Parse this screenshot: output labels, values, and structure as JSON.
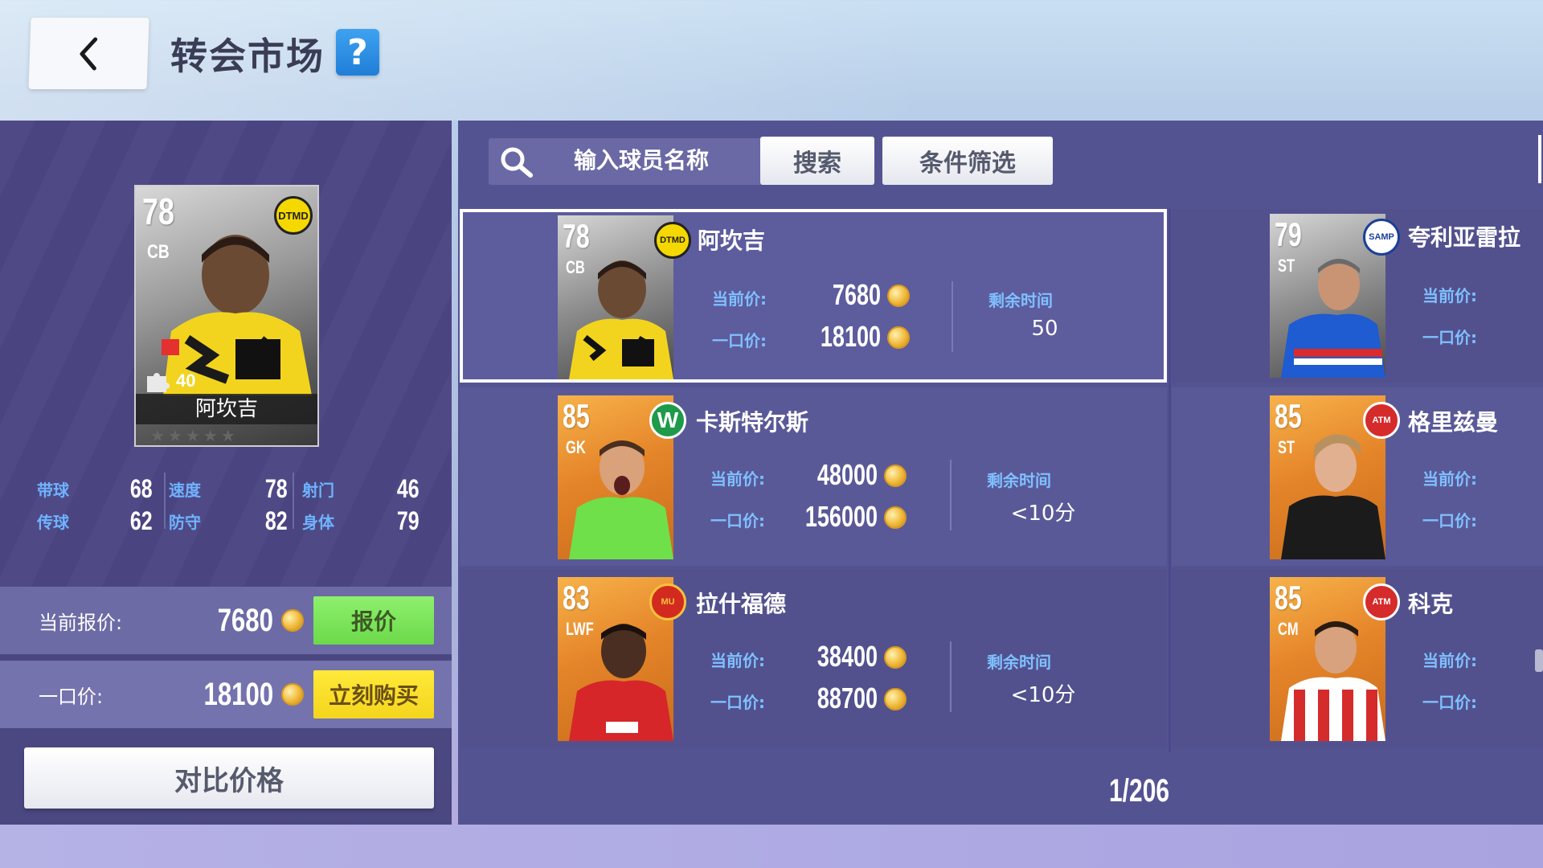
{
  "header": {
    "title": "转会市场",
    "help_label": "?"
  },
  "detail": {
    "rating": "78",
    "position": "CB",
    "level": "40",
    "name": "阿坎吉",
    "stats": [
      {
        "label": "带球",
        "value": "68"
      },
      {
        "label": "速度",
        "value": "78"
      },
      {
        "label": "射门",
        "value": "46"
      },
      {
        "label": "传球",
        "value": "62"
      },
      {
        "label": "防守",
        "value": "82"
      },
      {
        "label": "身体",
        "value": "79"
      }
    ],
    "current_bid_label": "当前报价:",
    "current_bid_value": "7680",
    "bid_button": "报价",
    "buyout_label": "一口价:",
    "buyout_value": "18100",
    "buy_button": "立刻购买",
    "compare_button": "对比价格"
  },
  "search": {
    "placeholder": "输入球员名称",
    "search_button": "搜索",
    "filter_button": "条件筛选"
  },
  "labels": {
    "current_price": "当前价:",
    "buyout_price": "一口价:",
    "remaining_time": "剩余时间"
  },
  "listings_left": [
    {
      "rating": "78",
      "position": "CB",
      "name": "阿坎吉",
      "current": "7680",
      "buyout": "18100",
      "time": "50",
      "badge": "DTMD 08"
    },
    {
      "rating": "85",
      "position": "GK",
      "name": "卡斯特尔斯",
      "current": "48000",
      "buyout": "156000",
      "time": "<10分",
      "badge": "W"
    },
    {
      "rating": "83",
      "position": "LWF",
      "name": "拉什福德",
      "current": "38400",
      "buyout": "88700",
      "time": "<10分",
      "badge": "MU"
    }
  ],
  "listings_right": [
    {
      "rating": "79",
      "position": "ST",
      "name": "夸利亚雷拉"
    },
    {
      "rating": "85",
      "position": "ST",
      "name": "格里兹曼"
    },
    {
      "rating": "85",
      "position": "CM",
      "name": "科克"
    }
  ],
  "pagination": "1/206",
  "colors": {
    "panel": "#4b4781",
    "list_panel": "#545392",
    "accent_label": "#7fc0ff",
    "bid_green": "#7fe65c",
    "buy_yellow": "#ffe02a",
    "help_blue": "#2b8de3"
  }
}
